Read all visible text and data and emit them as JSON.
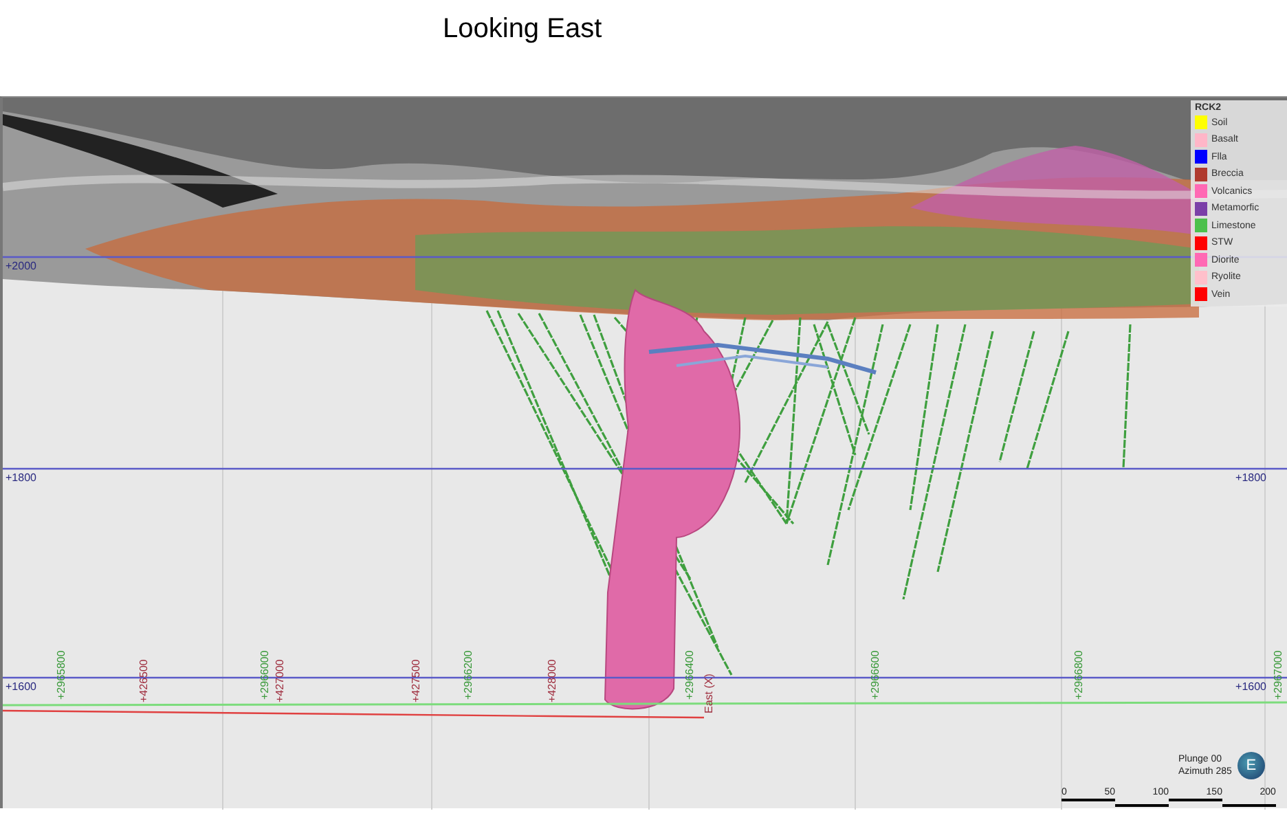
{
  "title": "Looking East",
  "viewport": {
    "elevation_lines": [
      {
        "left": "+2000"
      },
      {
        "left": "+1800",
        "right": "+1800"
      },
      {
        "left": "+1600",
        "right": "+1600"
      }
    ],
    "northings": [
      "+2965800",
      "+2966000",
      "+2966200",
      "+2966400",
      "+2966600",
      "+2966800",
      "+2967000"
    ],
    "eastings": [
      "+426500",
      "+427000",
      "+427500",
      "+428000"
    ],
    "east_axis_label": "East (X)",
    "legend": {
      "title": "RCK2",
      "items": [
        {
          "label": "Soil",
          "color": "#ffff00"
        },
        {
          "label": "Basalt",
          "color": "#ffb6c8"
        },
        {
          "label": "Flla",
          "color": "#0000ff"
        },
        {
          "label": "Breccia",
          "color": "#b03a2e"
        },
        {
          "label": "Volcanics",
          "color": "#ff69b4"
        },
        {
          "label": "Metamorfic",
          "color": "#7b3fa8"
        },
        {
          "label": "Limestone",
          "color": "#4cc04c"
        },
        {
          "label": "STW",
          "color": "#ff0000"
        },
        {
          "label": "Diorite",
          "color": "#ff69b4"
        },
        {
          "label": "Ryolite",
          "color": "#ffc0cb"
        },
        {
          "label": "Vein",
          "color": "#ff0000"
        }
      ]
    },
    "orientation": {
      "plunge": "Plunge 00",
      "azimuth": "Azimuth 285",
      "compass": "E"
    },
    "scale_bar": {
      "ticks": [
        "0",
        "50",
        "100",
        "150",
        "200"
      ]
    }
  }
}
